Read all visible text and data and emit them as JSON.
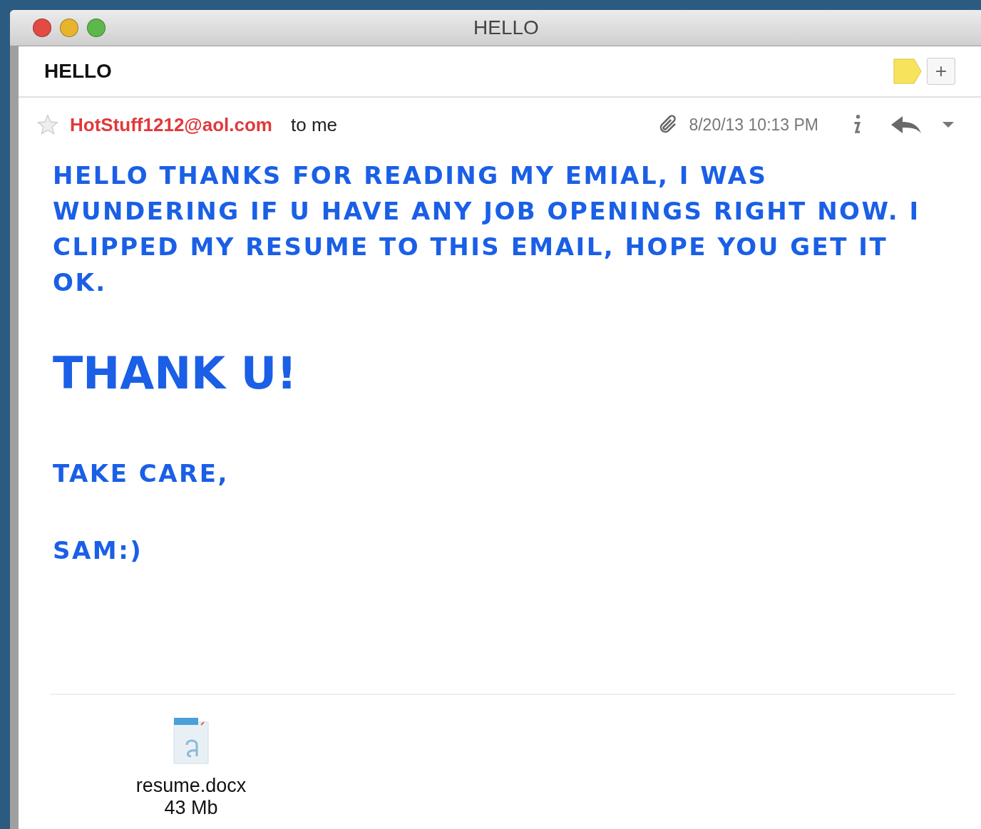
{
  "window": {
    "title": "HELLO"
  },
  "subject": "HELLO",
  "add_button": "+",
  "message": {
    "starred": false,
    "sender": "HotStuff1212@aol.com",
    "recipient": "to me",
    "date": "8/20/13 10:13 PM",
    "body": [
      {
        "kind": "paragraph",
        "text": "HELLO THANKS FOR READING MY EMIAL, I WAS WUNDERING IF U HAVE ANY JOB OPENINGS RIGHT NOW.  I CLIPPED MY RESUME TO THIS EMAIL, HOPE YOU GET IT OK."
      },
      {
        "kind": "headline",
        "text": "THANK U!"
      },
      {
        "kind": "paragraph",
        "text": "TAKE CARE,"
      },
      {
        "kind": "paragraph",
        "text": "SAM:)"
      }
    ]
  },
  "attachment": {
    "name": "resume.docx",
    "size": "43 Mb"
  }
}
